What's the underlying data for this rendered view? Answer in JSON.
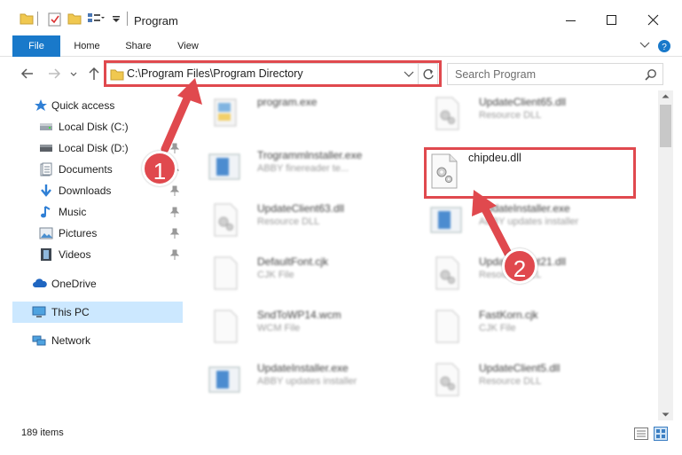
{
  "window": {
    "title": "Program",
    "minimize_icon": "minimize-icon",
    "maximize_icon": "maximize-icon",
    "close_icon": "close-icon"
  },
  "ribbon": {
    "tabs": [
      {
        "label": "File"
      },
      {
        "label": "Home"
      },
      {
        "label": "Share"
      },
      {
        "label": "View"
      }
    ]
  },
  "address": {
    "path": "C:\\Program Files\\Program Directory"
  },
  "search": {
    "placeholder": "Search Program"
  },
  "sidebar": {
    "items": [
      {
        "label": "Quick access",
        "icon": "star-icon"
      },
      {
        "label": "Local Disk (C:)",
        "icon": "drive-icon"
      },
      {
        "label": "Local Disk (D:)",
        "icon": "drive-icon"
      },
      {
        "label": "Documents",
        "icon": "documents-icon"
      },
      {
        "label": "Downloads",
        "icon": "download-icon"
      },
      {
        "label": "Music",
        "icon": "music-icon"
      },
      {
        "label": "Pictures",
        "icon": "pictures-icon"
      },
      {
        "label": "Videos",
        "icon": "videos-icon"
      },
      {
        "label": "OneDrive",
        "icon": "cloud-icon"
      },
      {
        "label": "This PC",
        "icon": "computer-icon"
      },
      {
        "label": "Network",
        "icon": "network-icon"
      }
    ]
  },
  "files": [
    {
      "name": "program.exe",
      "desc": ""
    },
    {
      "name": "UpdateClient65.dll",
      "desc": "Resource DLL"
    },
    {
      "name": "Trogrammlnstaller.exe",
      "desc": "ABBY finereader te..."
    },
    {
      "name": "UpdateClient63.dll",
      "desc": "Resource DLL"
    },
    {
      "name": "UpdateInstaller.exe",
      "desc": "ABBY updates installer"
    },
    {
      "name": "DefaultFont.cjk",
      "desc": "CJK File"
    },
    {
      "name": "UpdateClient21.dll",
      "desc": "Resource DLL"
    },
    {
      "name": "SndToWP14.wcm",
      "desc": "WCM File"
    },
    {
      "name": "FastKorn.cjk",
      "desc": "CJK File"
    },
    {
      "name": "UpdateInstaller.exe",
      "desc": "ABBY updates installer"
    },
    {
      "name": "UpdateClient5.dll",
      "desc": "Resource DLL"
    }
  ],
  "highlighted_file": {
    "name": "chipdeu.dll"
  },
  "status": {
    "item_count": "189 items"
  },
  "annotations": {
    "step1": "1",
    "step2": "2",
    "color": "#e0494e"
  }
}
